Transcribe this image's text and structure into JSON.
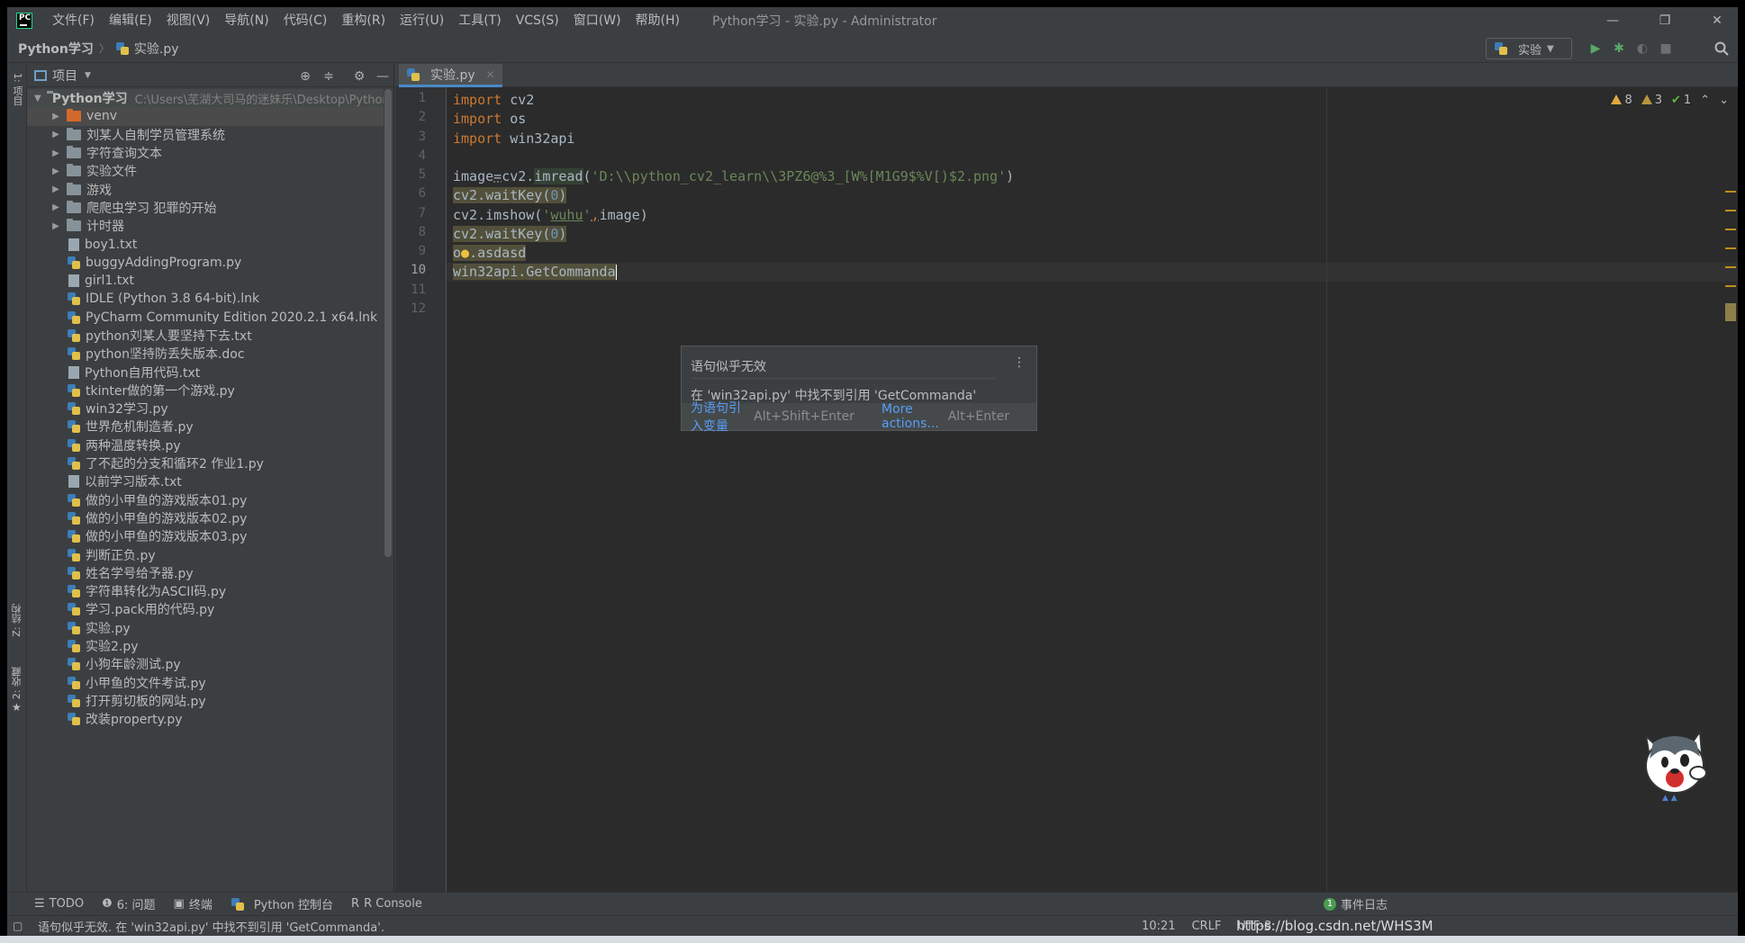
{
  "window": {
    "title": "Python学习 - 实验.py - Administrator",
    "menu": [
      "文件(F)",
      "编辑(E)",
      "视图(V)",
      "导航(N)",
      "代码(C)",
      "重构(R)",
      "运行(U)",
      "工具(T)",
      "VCS(S)",
      "窗口(W)",
      "帮助(H)"
    ],
    "minimize": "—",
    "restore": "❐",
    "close": "✕"
  },
  "navbar": {
    "project": "Python学习",
    "file": "实验.py",
    "run_config": "实验"
  },
  "left_stripe": {
    "project_tab": "1: 项目",
    "structure_tab": "Z: 结构",
    "favorites_tab": "2: 收藏"
  },
  "project_panel": {
    "title": "项目",
    "root_name": "Python学习",
    "root_path": "C:\\Users\\芜湖大司马的迷妹乐\\Desktop\\Python学",
    "folders": [
      "venv",
      "刘某人自制学员管理系统",
      "字符查询文本",
      "实验文件",
      "游戏",
      "爬爬虫学习 犯罪的开始",
      "计时器"
    ],
    "files": [
      {
        "name": "boy1.txt",
        "type": "txt"
      },
      {
        "name": "buggyAddingProgram.py",
        "type": "py"
      },
      {
        "name": "girl1.txt",
        "type": "txt"
      },
      {
        "name": "IDLE (Python 3.8 64-bit).lnk",
        "type": "py"
      },
      {
        "name": "PyCharm Community Edition 2020.2.1 x64.lnk",
        "type": "py"
      },
      {
        "name": "python刘某人要坚持下去.txt",
        "type": "py"
      },
      {
        "name": "python坚持防丢失版本.doc",
        "type": "py"
      },
      {
        "name": "Python自用代码.txt",
        "type": "txt"
      },
      {
        "name": "tkinter做的第一个游戏.py",
        "type": "py"
      },
      {
        "name": "win32学习.py",
        "type": "py"
      },
      {
        "name": "世界危机制造者.py",
        "type": "py"
      },
      {
        "name": "两种温度转换.py",
        "type": "py"
      },
      {
        "name": "了不起的分支和循环2 作业1.py",
        "type": "py"
      },
      {
        "name": "以前学习版本.txt",
        "type": "txt"
      },
      {
        "name": "做的小甲鱼的游戏版本01.py",
        "type": "py"
      },
      {
        "name": "做的小甲鱼的游戏版本02.py",
        "type": "py"
      },
      {
        "name": "做的小甲鱼的游戏版本03.py",
        "type": "py"
      },
      {
        "name": "判断正负.py",
        "type": "py"
      },
      {
        "name": "姓名学号给予器.py",
        "type": "py"
      },
      {
        "name": "字符串转化为ASCII码.py",
        "type": "py"
      },
      {
        "name": "学习.pack用的代码.py",
        "type": "py"
      },
      {
        "name": "实验.py",
        "type": "py"
      },
      {
        "name": "实验2.py",
        "type": "py"
      },
      {
        "name": "小狗年龄测试.py",
        "type": "py"
      },
      {
        "name": "小甲鱼的文件考试.py",
        "type": "py"
      },
      {
        "name": "打开剪切板的网站.py",
        "type": "py"
      },
      {
        "name": "改装property.py",
        "type": "py"
      }
    ]
  },
  "editor": {
    "tab_label": "实验.py",
    "line_numbers": [
      "1",
      "2",
      "3",
      "4",
      "5",
      "6",
      "7",
      "8",
      "9",
      "10",
      "11",
      "12"
    ],
    "inspection": {
      "warnings": "8",
      "weak_warnings": "3",
      "typos": "1"
    },
    "code": {
      "l1_kw": "import",
      "l1_mod": " cv2",
      "l2_kw": "import",
      "l2_mod": " os",
      "l3_kw": "import",
      "l3_mod": " win32api",
      "l5_a": "image",
      "l5_eq": "=",
      "l5_b": "cv2.",
      "l5_fn": "imread",
      "l5_c": "(",
      "l5_str": "'D:\\\\python_cv2_learn\\\\3PZ6@%3_[W%[M1G9$%V[)$2.png'",
      "l5_d": ")",
      "l6_a": "cv2.",
      "l6_fn": "waitKey",
      "l6_b": "(",
      "l6_num": "0",
      "l6_c": ")",
      "l7_a": "cv2.imshow(",
      "l7_q1": "'",
      "l7_str": "wuhu",
      "l7_q2": "'",
      "l7_comma": ",",
      "l7_b": "image)",
      "l8_a": "cv2.",
      "l8_fn": "waitKey",
      "l8_b": "(",
      "l8_num": "0",
      "l8_c": ")",
      "l9_a": "o",
      "l9_b": ".asdasd",
      "l10": "win32api.GetCommanda"
    }
  },
  "popup": {
    "title": "语句似乎无效",
    "message": "在 'win32api.py' 中找不到引用 'GetCommanda'",
    "action1": "为语句引入变量",
    "action1_shortcut": "Alt+Shift+Enter",
    "action2": "More actions...",
    "action2_shortcut": "Alt+Enter"
  },
  "bottom_tools": [
    "TODO",
    "6: 问题",
    "终端",
    "Python 控制台",
    "R Console"
  ],
  "event_log": {
    "count": "1",
    "label": "事件日志"
  },
  "status": {
    "message": "语句似乎无效. 在 'win32api.py' 中找不到引用 'GetCommanda'.",
    "position": "10:21",
    "line_sep": "CRLF",
    "encoding": "UTF-8",
    "watermark": "https://blog.csdn.net/WHS3M"
  },
  "colors": {
    "keyword": "#cc7832",
    "string": "#6a8759",
    "number": "#6897bb",
    "link": "#589df6",
    "run_green": "#59a869"
  }
}
